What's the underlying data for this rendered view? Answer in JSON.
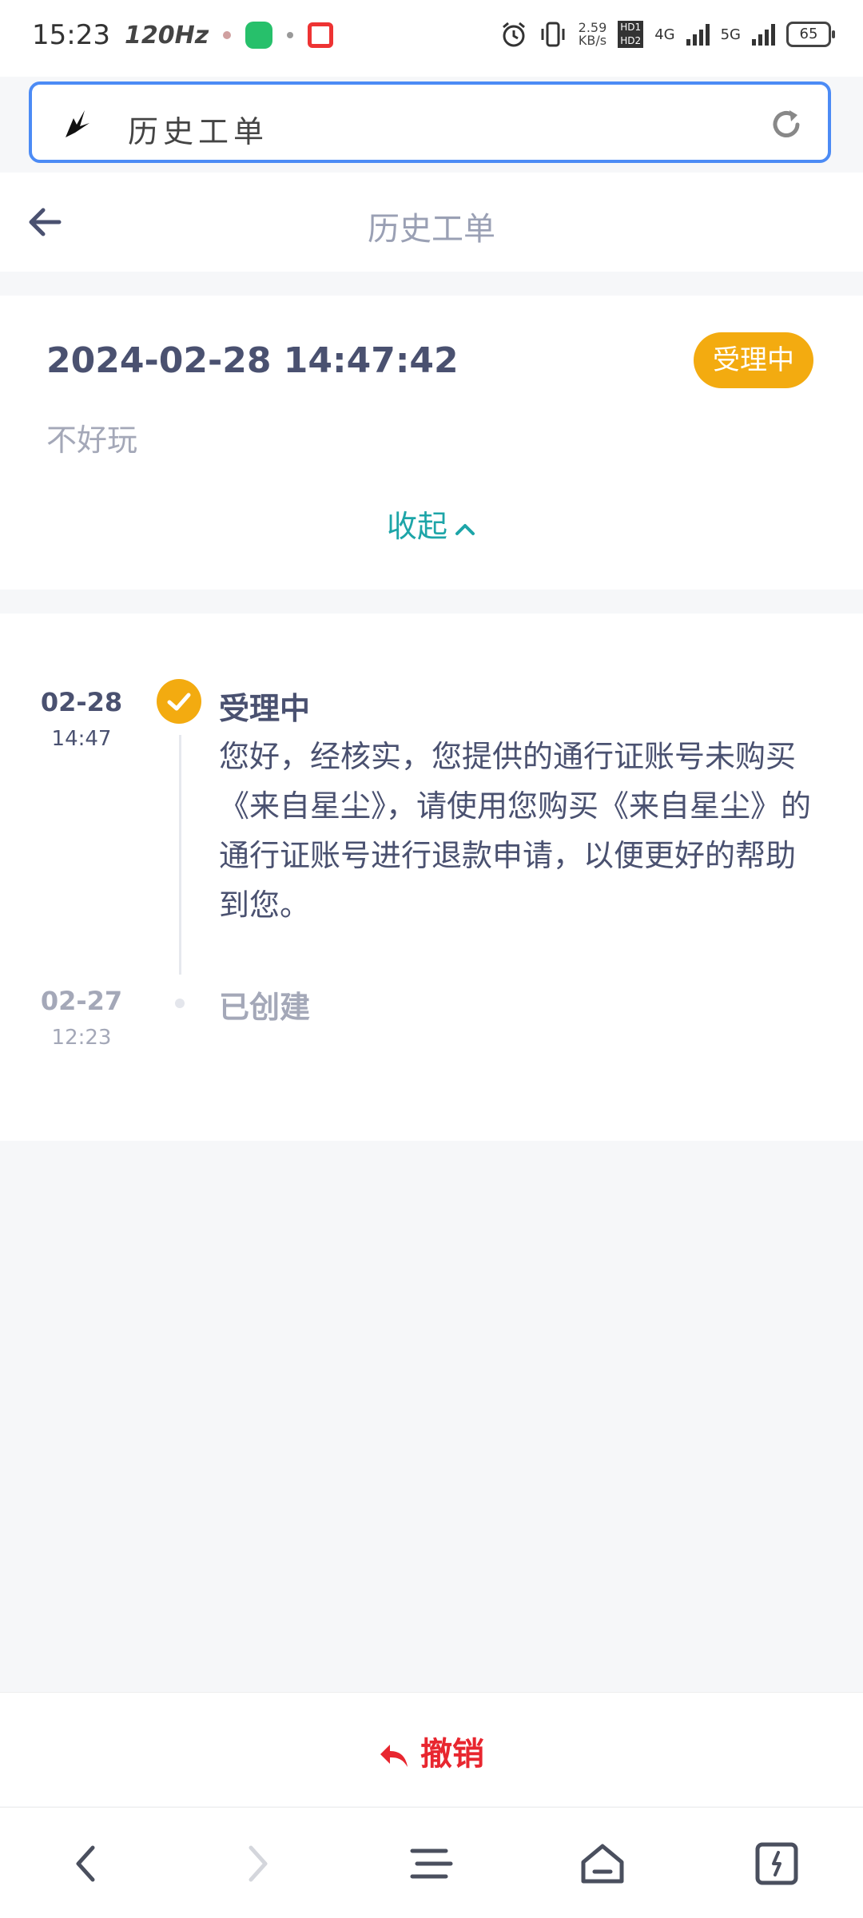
{
  "status_bar": {
    "time": "15:23",
    "refresh_rate": "120Hz",
    "net_speed_value": "2.59",
    "net_speed_unit": "KB/s",
    "hd1": "HD1",
    "hd2": "HD2",
    "network_4g": "4G",
    "network_5g": "5G",
    "battery": "65"
  },
  "browser": {
    "address_title": "历史工单"
  },
  "header": {
    "title": "历史工单"
  },
  "ticket": {
    "datetime": "2024-02-28 14:47:42",
    "status_badge": "受理中",
    "description": "不好玩",
    "collapse_label": "收起"
  },
  "timeline": [
    {
      "date": "02-28",
      "time": "14:47",
      "status": "受理中",
      "message": "您好，经核实，您提供的通行证账号未购买《来自星尘》，请使用您购买《来自星尘》的通行证账号进行退款申请，以便更好的帮助到您。"
    },
    {
      "date": "02-27",
      "time": "12:23",
      "status": "已创建"
    }
  ],
  "actions": {
    "cancel_label": "撤销"
  },
  "colors": {
    "accent_orange": "#f3ab10",
    "accent_teal": "#1da5a8",
    "cancel_red": "#e8262f",
    "browser_blue": "#4c8bf5"
  }
}
